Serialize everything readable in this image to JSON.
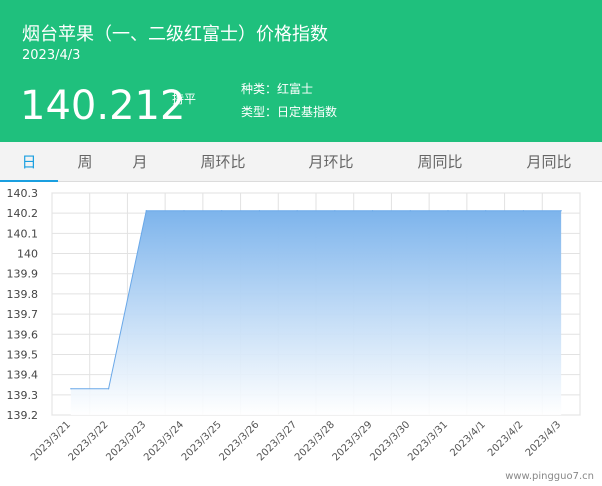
{
  "header": {
    "title": "烟台苹果（一、二级红富士）价格指数",
    "date": "2023/4/3",
    "price": "140.212",
    "trend": "持平",
    "kind": "种类：红富士",
    "type": "类型：日定基指数"
  },
  "tabs": [
    {
      "label": "日",
      "active": true
    },
    {
      "label": "周",
      "active": false
    },
    {
      "label": "月",
      "active": false
    },
    {
      "label": "周环比",
      "active": false
    },
    {
      "label": "月环比",
      "active": false
    },
    {
      "label": "周同比",
      "active": false
    },
    {
      "label": "月同比",
      "active": false
    }
  ],
  "watermark": "www.pingguo7.cn",
  "colors": {
    "header_bg": "#1fc07d",
    "tab_active": "#1a9fe0",
    "area_top": "#7db4ec",
    "area_bottom": "#ffffff",
    "line": "#6aa8e8"
  },
  "chart_data": {
    "type": "area",
    "x": [
      "2023/3/21",
      "2023/3/22",
      "2023/3/23",
      "2023/3/24",
      "2023/3/25",
      "2023/3/26",
      "2023/3/27",
      "2023/3/28",
      "2023/3/29",
      "2023/3/30",
      "2023/3/31",
      "2023/4/1",
      "2023/4/2",
      "2023/4/3"
    ],
    "values": [
      139.33,
      139.33,
      140.212,
      140.212,
      140.212,
      140.212,
      140.212,
      140.212,
      140.212,
      140.212,
      140.212,
      140.212,
      140.212,
      140.212
    ],
    "ylim": [
      139.2,
      140.3
    ],
    "yticks": [
      "139.2",
      "139.3",
      "139.4",
      "139.5",
      "139.6",
      "139.7",
      "139.8",
      "139.9",
      "140",
      "140.1",
      "140.2",
      "140.3"
    ],
    "grid": true,
    "title": "",
    "xlabel": "",
    "ylabel": ""
  }
}
